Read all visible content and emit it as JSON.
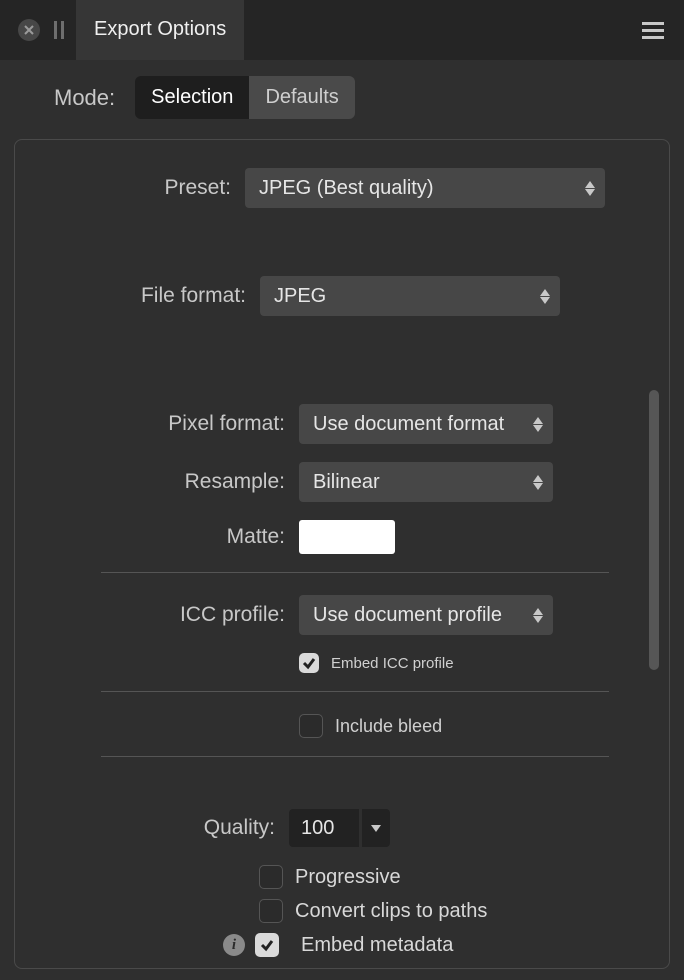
{
  "title": "Export Options",
  "mode": {
    "label": "Mode:",
    "selection": "Selection",
    "defaults": "Defaults"
  },
  "preset": {
    "label": "Preset:",
    "value": "JPEG (Best quality)"
  },
  "file_format": {
    "label": "File format:",
    "value": "JPEG"
  },
  "pixel_format": {
    "label": "Pixel format:",
    "value": "Use document format"
  },
  "resample": {
    "label": "Resample:",
    "value": "Bilinear"
  },
  "matte": {
    "label": "Matte:",
    "color": "#ffffff"
  },
  "icc_profile": {
    "label": "ICC profile:",
    "value": "Use document profile"
  },
  "embed_icc": {
    "label": "Embed ICC profile",
    "checked": true
  },
  "include_bleed": {
    "label": "Include bleed",
    "checked": false
  },
  "quality": {
    "label": "Quality:",
    "value": "100"
  },
  "progressive": {
    "label": "Progressive",
    "checked": false
  },
  "convert_clips": {
    "label": "Convert clips to paths",
    "checked": false
  },
  "embed_metadata": {
    "label": "Embed metadata",
    "checked": true
  }
}
